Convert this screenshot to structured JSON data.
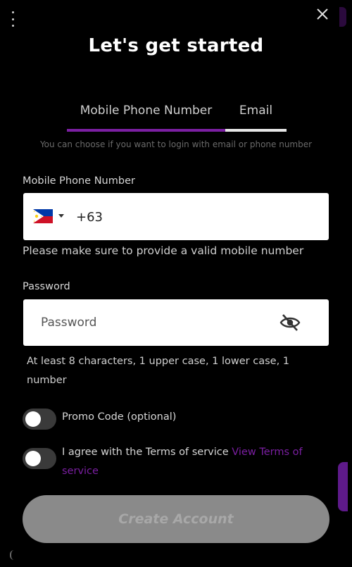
{
  "header": {
    "title": "Let's get started"
  },
  "tabs": {
    "phone_label": "Mobile Phone Number",
    "email_label": "Email",
    "hint": "You can choose if you want to login with email or phone number"
  },
  "phone": {
    "label": "Mobile Phone Number",
    "country_flag_icon": "philippines-flag-icon",
    "value": "+63",
    "helper": "Please make sure to provide a valid mobile number"
  },
  "password": {
    "label": "Password",
    "placeholder": "Password",
    "toggle_icon": "eye-off-icon",
    "helper": "At least 8 characters, 1 upper case, 1 lower case, 1 number"
  },
  "promo": {
    "label": "Promo Code (optional)",
    "enabled": false
  },
  "terms": {
    "text": "I agree with the Terms of service",
    "link_text": "View Terms of service",
    "enabled": false
  },
  "submit": {
    "label": "Create Account"
  },
  "colors": {
    "accent": "#7b1fa2",
    "background": "#000000",
    "disabled_button": "#8a8a8a"
  }
}
